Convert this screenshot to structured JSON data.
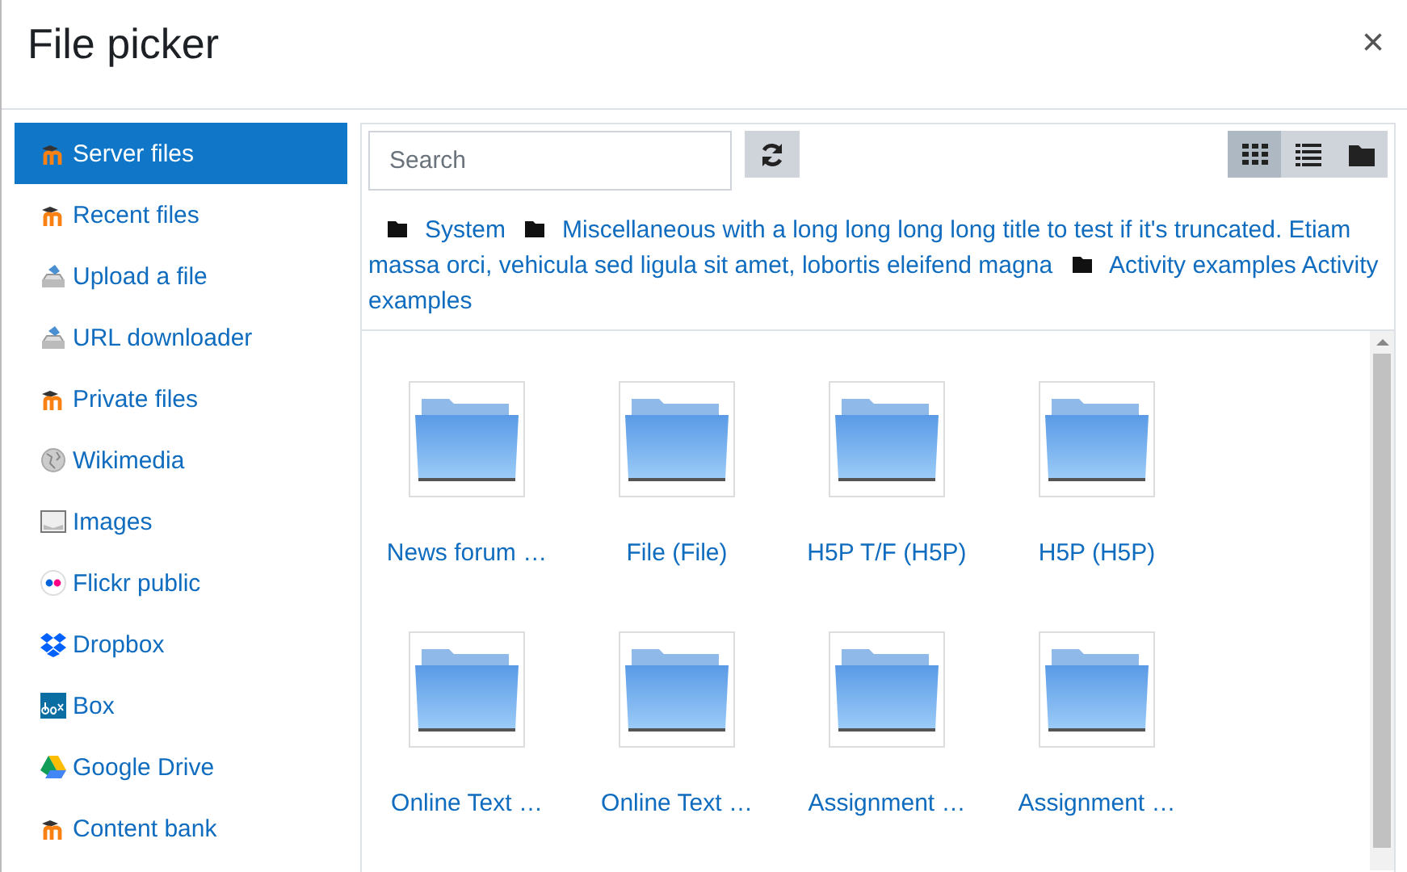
{
  "window": {
    "title": "File picker",
    "close": "×"
  },
  "sidebar": {
    "items": [
      {
        "label": "Server files",
        "selected": true
      },
      {
        "label": "Recent files",
        "selected": false
      },
      {
        "label": "Upload a file",
        "selected": false
      },
      {
        "label": "URL downloader",
        "selected": false
      },
      {
        "label": "Private files",
        "selected": false
      },
      {
        "label": "Wikimedia",
        "selected": false
      },
      {
        "label": "Images",
        "selected": false
      },
      {
        "label": "Flickr public",
        "selected": false
      },
      {
        "label": "Dropbox",
        "selected": false
      },
      {
        "label": "Box",
        "selected": false
      },
      {
        "label": "Google Drive",
        "selected": false
      },
      {
        "label": "Content bank",
        "selected": false
      }
    ]
  },
  "search": {
    "placeholder": "Search"
  },
  "view_modes": [
    {
      "kind": "icons",
      "selected": true
    },
    {
      "kind": "list",
      "selected": false
    },
    {
      "kind": "tree",
      "selected": false
    }
  ],
  "breadcrumb": [
    {
      "lines": [
        "System"
      ]
    },
    {
      "lines": [
        "Miscellaneous with a long long long long title to test if it's truncated. Etiam",
        "massa orci, vehicula sed ligula sit amet, lobortis eleifend magna"
      ]
    },
    {
      "lines": [
        "Activity examples Activity",
        "examples"
      ]
    }
  ],
  "files": [
    {
      "label": "News forum …"
    },
    {
      "label": "File (File)"
    },
    {
      "label": "H5P T/F (H5P)"
    },
    {
      "label": "H5P (H5P)"
    },
    {
      "label": "Online Text …"
    },
    {
      "label": "Online Text …"
    },
    {
      "label": "Assignment …"
    },
    {
      "label": "Assignment …"
    }
  ]
}
